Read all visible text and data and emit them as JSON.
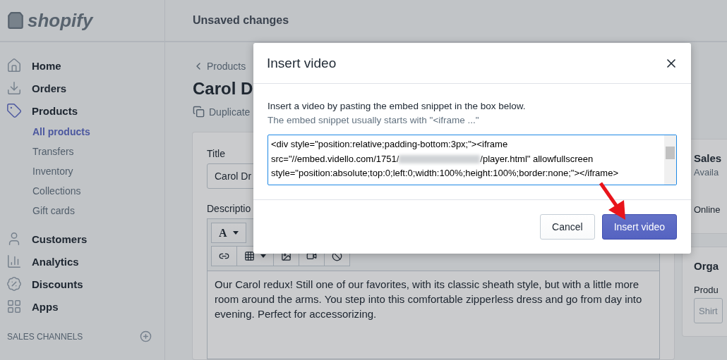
{
  "sidebar": {
    "logo": "shopify",
    "items": [
      {
        "label": "Home",
        "selected": false
      },
      {
        "label": "Orders",
        "selected": false
      },
      {
        "label": "Products",
        "selected": true,
        "children": [
          {
            "label": "All products",
            "selected": true
          },
          {
            "label": "Transfers",
            "selected": false
          },
          {
            "label": "Inventory",
            "selected": false
          },
          {
            "label": "Collections",
            "selected": false
          },
          {
            "label": "Gift cards",
            "selected": false
          }
        ]
      },
      {
        "label": "Customers",
        "selected": false
      },
      {
        "label": "Analytics",
        "selected": false
      },
      {
        "label": "Discounts",
        "selected": false
      },
      {
        "label": "Apps",
        "selected": false
      }
    ],
    "section_heading": "SALES CHANNELS"
  },
  "top_bar": {
    "title": "Unsaved changes"
  },
  "page": {
    "breadcrumb": "Products",
    "title": "Carol D",
    "actions": [
      "Duplicate"
    ],
    "title_field": {
      "label": "Title",
      "value": "Carol Dr"
    },
    "description": {
      "label": "Descriptio",
      "font_button": "A",
      "text": "Our Carol redux! Still one of our favorites, with its classic sheath style, but with a little more room around the arms. You step into this comfortable zipperless dress and go from day into evening. Perfect for accessorizing."
    },
    "side_cards": [
      {
        "heading": "Sales",
        "subtext": "Availa",
        "row": "Online"
      },
      {
        "heading": "Orga",
        "field_label": "Produ",
        "placeholder": "Shirt"
      }
    ]
  },
  "modal": {
    "title": "Insert video",
    "instructions": "Insert a video by pasting the embed snippet in the box below.",
    "hint": "The embed snippet usually starts with \"<iframe ...\"",
    "code_lines": [
      {
        "text": "<div style=\"position:relative;padding-bottom:3px;\"><iframe",
        "redacted": false
      },
      {
        "text": "src=\"//embed.vidello.com/1751/",
        "redacted": true,
        "text_after": "/player.html\" allowfullscreen"
      },
      {
        "text": "style=\"position:absolute;top:0;left:0;width:100%;height:100%;border:none;\"></iframe>",
        "redacted": false
      }
    ],
    "buttons": [
      {
        "label": "Cancel",
        "kind": "secondary"
      },
      {
        "label": "Insert video",
        "kind": "primary"
      }
    ]
  }
}
